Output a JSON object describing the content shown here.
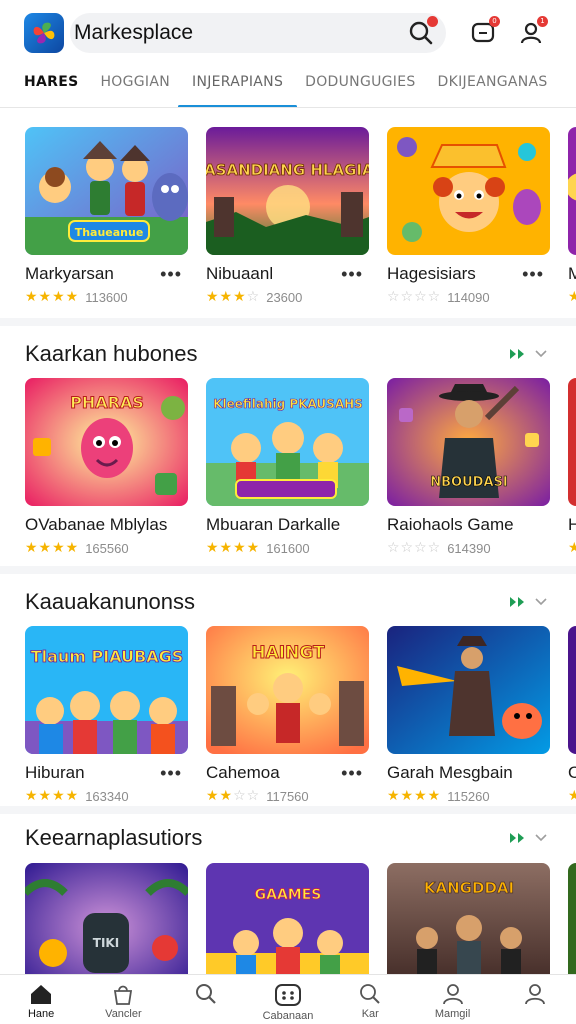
{
  "header": {
    "app_icon": "four-petal-logo-icon",
    "search_value": "Markesplace",
    "icons": [
      "search-icon",
      "chat-icon",
      "user-icon"
    ],
    "chat_badge": "0",
    "profile_badge": "1"
  },
  "tabs": [
    {
      "label": "HARES"
    },
    {
      "label": "HOGGIAN"
    },
    {
      "label": "INJERAPIANS"
    },
    {
      "label": "DODUNGUGIES"
    },
    {
      "label": "DKIJEANGANAS"
    }
  ],
  "sections": [
    {
      "title": "",
      "games": [
        {
          "name": "Markyarsan",
          "stars": 4,
          "count": "113600",
          "art_text": "Thaueanue"
        },
        {
          "name": "Nibuaanl",
          "stars": 3,
          "count": "23600",
          "art_text": "DASANDIANG HLAGIAS"
        },
        {
          "name": "Hagesisiars",
          "stars": 0,
          "count": "114090",
          "art_text": ""
        },
        {
          "name": "M",
          "stars": 4,
          "count": "",
          "art_text": ""
        }
      ]
    },
    {
      "title": "Kaarkan hubones",
      "games": [
        {
          "name": "OVabanae Mblylas",
          "stars": 4,
          "count": "165560",
          "art_text": "PHARAS"
        },
        {
          "name": "Mbuaran Darkalle",
          "stars": 4,
          "count": "161600",
          "art_text": "Kleefilahig PKAUSAHS"
        },
        {
          "name": "Raiohaols Game",
          "stars": 0,
          "count": "614390",
          "art_text": "NBOUDASI"
        },
        {
          "name": "H",
          "stars": 4,
          "count": "",
          "art_text": ""
        }
      ]
    },
    {
      "title": "Kaauakanunonss",
      "games": [
        {
          "name": "Hiburan",
          "stars": 4,
          "count": "163340",
          "art_text": "Tlaum PIAUBAGS"
        },
        {
          "name": "Cahemoa",
          "stars": 2,
          "count": "117560",
          "art_text": "HAINGT"
        },
        {
          "name": "Garah Mesgbain",
          "stars": 4,
          "count": "115260",
          "art_text": ""
        },
        {
          "name": "O",
          "stars": 4,
          "count": "",
          "art_text": ""
        }
      ]
    },
    {
      "title": "Keearnaplasutiors",
      "games": [
        {
          "name": "",
          "stars": 0,
          "count": "",
          "art_text": "TIKI"
        },
        {
          "name": "",
          "stars": 0,
          "count": "",
          "art_text": "GAAMES"
        },
        {
          "name": "",
          "stars": 0,
          "count": "",
          "art_text": "KANGDDAI"
        },
        {
          "name": "",
          "stars": 0,
          "count": "",
          "art_text": ""
        }
      ]
    }
  ],
  "bottom_nav": [
    {
      "label": "Hane",
      "icon": "home-icon"
    },
    {
      "label": "Vancler",
      "icon": "bag-icon"
    },
    {
      "label": "",
      "icon": "search-icon"
    },
    {
      "label": "Cabanaan",
      "icon": "gamepad-icon"
    },
    {
      "label": "Kar",
      "icon": "magnifier-icon"
    },
    {
      "label": "Mamgil",
      "icon": "profile-icon"
    },
    {
      "label": "",
      "icon": "account-icon"
    }
  ],
  "colors": {
    "accent": "#1a8fd8",
    "star": "#f6b400",
    "more_arrow": "#1f9d55",
    "badge": "#e53935"
  }
}
